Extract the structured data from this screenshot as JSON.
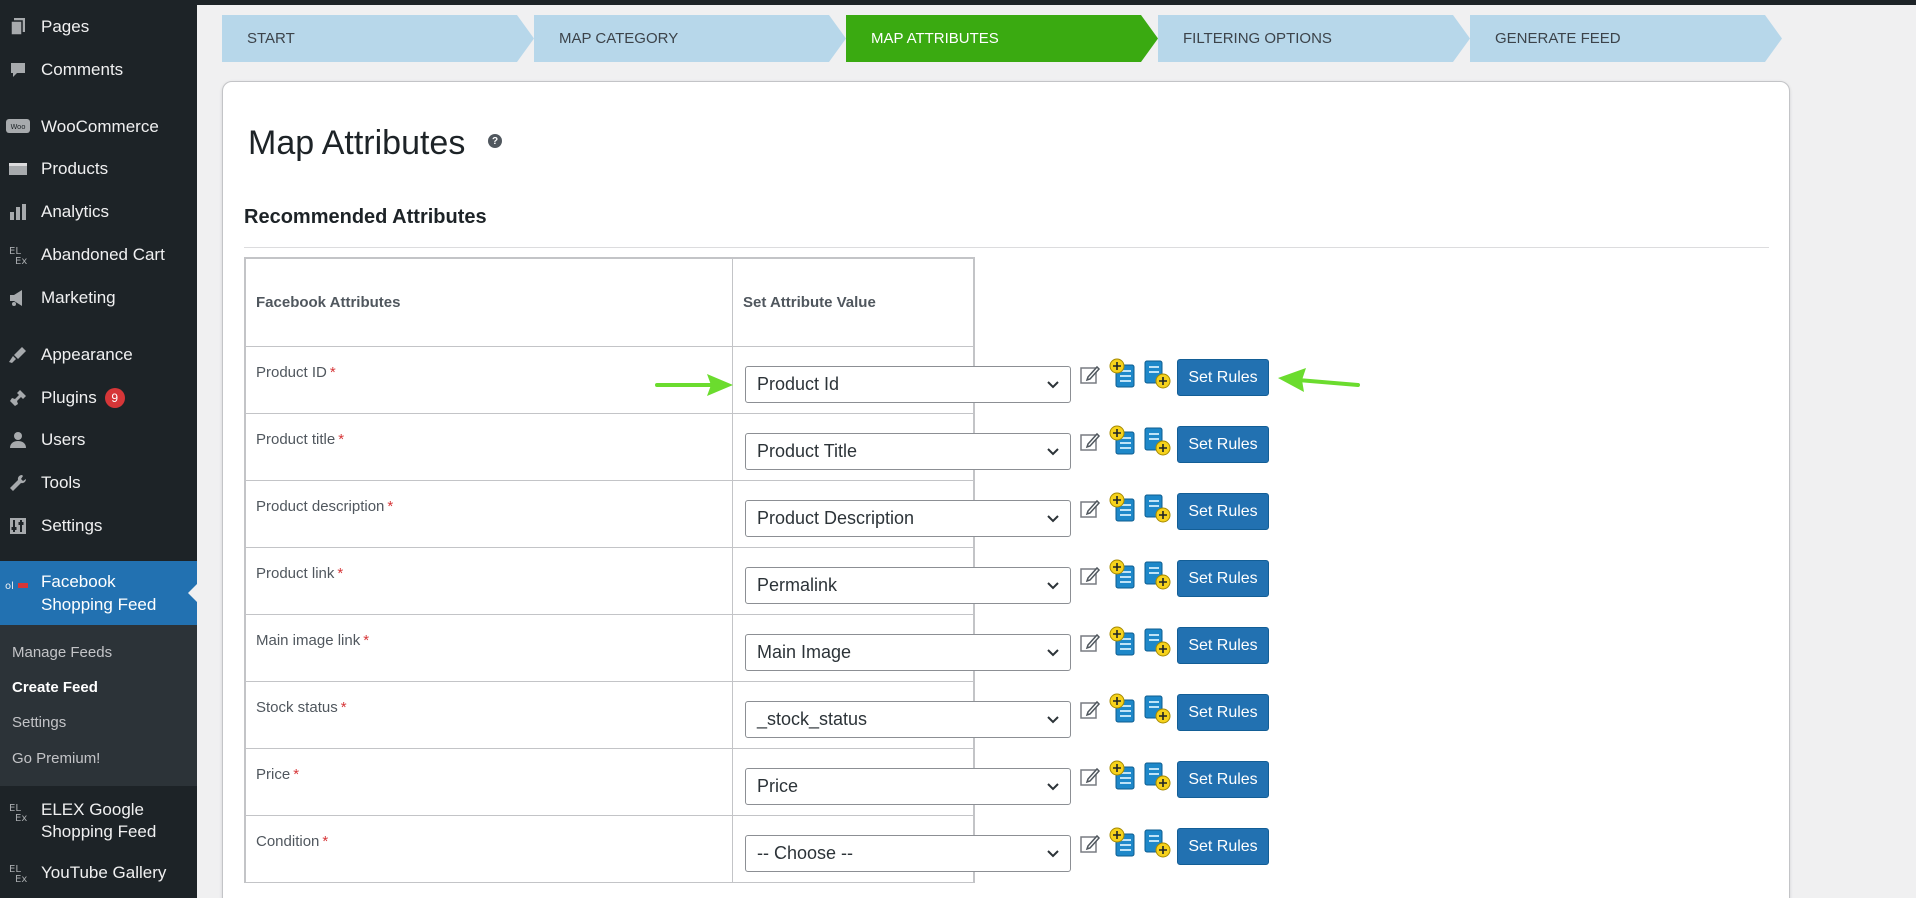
{
  "sidebar": {
    "items": [
      {
        "label": "Pages",
        "icon": "pages-icon"
      },
      {
        "label": "Comments",
        "icon": "comments-icon"
      },
      {
        "label": "WooCommerce",
        "icon": "woocommerce-icon"
      },
      {
        "label": "Products",
        "icon": "products-icon"
      },
      {
        "label": "Analytics",
        "icon": "analytics-icon"
      },
      {
        "label": "Abandoned Cart",
        "icon": "elex-icon"
      },
      {
        "label": "Marketing",
        "icon": "marketing-icon"
      },
      {
        "label": "Appearance",
        "icon": "appearance-icon"
      },
      {
        "label": "Plugins",
        "icon": "plugins-icon",
        "badge": "9"
      },
      {
        "label": "Users",
        "icon": "users-icon"
      },
      {
        "label": "Tools",
        "icon": "tools-icon"
      },
      {
        "label": "Settings",
        "icon": "settings-icon"
      }
    ],
    "active": {
      "label_line1": "Facebook",
      "label_line2": "Shopping Feed",
      "icon": "facebook-feed-icon"
    },
    "submenu": [
      "Manage Feeds",
      "Create Feed",
      "Settings",
      "Go Premium!"
    ],
    "submenu_current": "Create Feed",
    "after": [
      {
        "label_line1": "ELEX Google",
        "label_line2": "Shopping Feed",
        "icon": "elex-icon"
      },
      {
        "label": "YouTube Gallery",
        "icon": "elex-icon"
      }
    ]
  },
  "steps": [
    {
      "label": "START"
    },
    {
      "label": "MAP CATEGORY"
    },
    {
      "label": "MAP ATTRIBUTES",
      "active": true
    },
    {
      "label": "FILTERING OPTIONS"
    },
    {
      "label": "GENERATE FEED"
    }
  ],
  "main": {
    "title": "Map Attributes",
    "help": "?",
    "section_title": "Recommended Attributes",
    "table": {
      "headers": [
        "Facebook Attributes",
        "Set Attribute Value"
      ],
      "required_mark": "*",
      "button_label": "Set Rules",
      "rows": [
        {
          "attribute": "Product ID",
          "value": "Product Id"
        },
        {
          "attribute": "Product title",
          "value": "Product Title"
        },
        {
          "attribute": "Product description",
          "value": "Product Description"
        },
        {
          "attribute": "Product link",
          "value": "Permalink"
        },
        {
          "attribute": "Main image link",
          "value": "Main Image"
        },
        {
          "attribute": "Stock status",
          "value": "_stock_status"
        },
        {
          "attribute": "Price",
          "value": "Price"
        },
        {
          "attribute": "Condition",
          "value": "-- Choose --"
        }
      ]
    }
  },
  "colors": {
    "sidebar_bg": "#1d2327",
    "active_menu": "#2271b1",
    "step_inactive": "#b7d7ea",
    "step_active": "#3aaa11",
    "button": "#2271b1",
    "annotation_arrow": "#6bdc2e"
  }
}
